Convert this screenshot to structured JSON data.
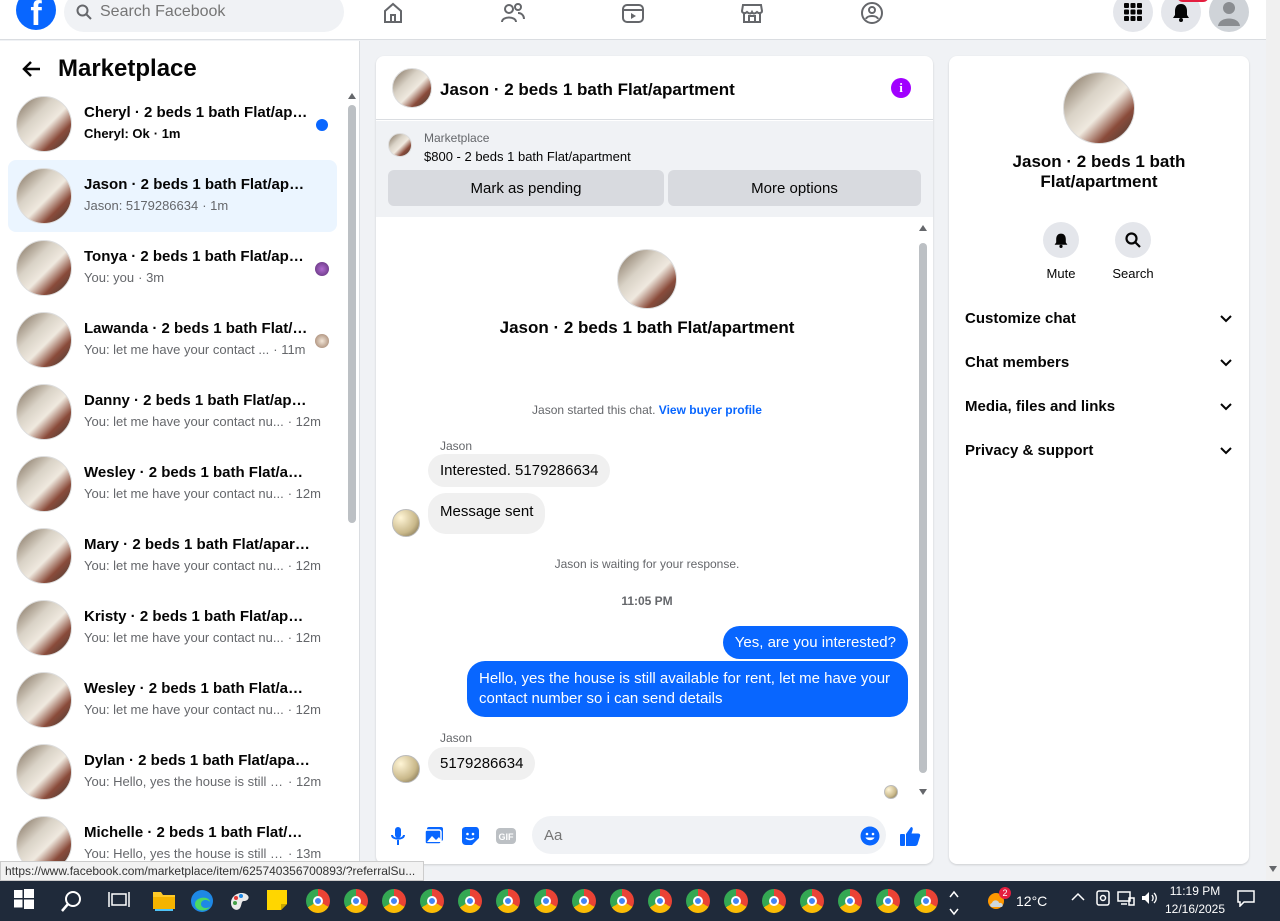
{
  "topbar": {
    "logo": "f",
    "search_placeholder": "Search Facebook",
    "nav_icons": [
      "home-icon",
      "friends-icon",
      "video-icon",
      "marketplace-icon",
      "groups-icon"
    ],
    "menu_icon": "grid-menu-icon",
    "notifications_icon": "bell-icon",
    "profile_icon": "account-avatar"
  },
  "left": {
    "title": "Marketplace",
    "conversations": [
      {
        "title": "Cheryl · 2 beds 1 bath Flat/apartment",
        "preview": "Cheryl: Ok",
        "time": "· 1m",
        "unread": true
      },
      {
        "title": "Jason · 2 beds 1 bath Flat/apartment",
        "preview": "Jason: 5179286634",
        "time": "· 1m",
        "active": true
      },
      {
        "title": "Tonya · 2 beds 1 bath Flat/apartment",
        "preview": "You: you",
        "time": "· 3m"
      },
      {
        "title": "Lawanda · 2 beds 1 bath Flat/apartment",
        "preview": "You: let me have your contact ...",
        "time": "· 11m"
      },
      {
        "title": "Danny · 2 beds 1 bath Flat/apartment",
        "preview": "You: let me have your contact nu...",
        "time": "· 12m"
      },
      {
        "title": "Wesley · 2 beds 1 bath Flat/apartment",
        "preview": "You: let me have your contact nu...",
        "time": "· 12m"
      },
      {
        "title": "Mary · 2 beds 1 bath Flat/apartment",
        "preview": "You: let me have your contact nu...",
        "time": "· 12m"
      },
      {
        "title": "Kristy · 2 beds 1 bath Flat/apartment",
        "preview": "You: let me have your contact nu...",
        "time": "· 12m"
      },
      {
        "title": "Wesley · 2 beds 1 bath Flat/apartment",
        "preview": "You: let me have your contact nu...",
        "time": "· 12m"
      },
      {
        "title": "Dylan · 2 beds 1 bath Flat/apartment",
        "preview": "You: Hello, yes the house is still a...",
        "time": "· 12m"
      },
      {
        "title": "Michelle · 2 beds 1 bath Flat/apartment",
        "preview": "You: Hello, yes the house is still a...",
        "time": "· 13m"
      }
    ]
  },
  "chat": {
    "header_name": "Jason · 2 beds 1 bath Flat/apartment",
    "listing_label": "Marketplace",
    "listing_price": "$800 - 2 beds 1 bath Flat/apartment",
    "mark_pending": "Mark as pending",
    "more_options": "More options",
    "title": "Jason · 2 beds 1 bath Flat/apartment",
    "started_text": "Jason started this chat.",
    "view_profile": "View buyer profile",
    "sender1": "Jason",
    "msg1": "Interested. 5179286634",
    "msg2": "Message sent",
    "waiting": "Jason is waiting for your response.",
    "time": "11:05 PM",
    "out1": "Yes, are you interested?",
    "out2": "Hello, yes the house is still available for rent, let me have your contact number so i can send details",
    "sender2": "Jason",
    "msg3": "5179286634",
    "input_placeholder": "Aa"
  },
  "right": {
    "title": "Jason · 2 beds 1 bath Flat/apartment",
    "mute": "Mute",
    "search": "Search",
    "items": [
      "Customize chat",
      "Chat members",
      "Media, files and links",
      "Privacy & support"
    ]
  },
  "status_url": "https://www.facebook.com/marketplace/item/625740356700893/?referralSu...",
  "taskbar": {
    "weather_badge": "2",
    "temperature": "12°C",
    "time": "11:19 PM",
    "date": "12/16/2025"
  },
  "colors": {
    "accent": "#0866ff",
    "info": "#a100ff",
    "taskbar": "#1f2a3a"
  }
}
